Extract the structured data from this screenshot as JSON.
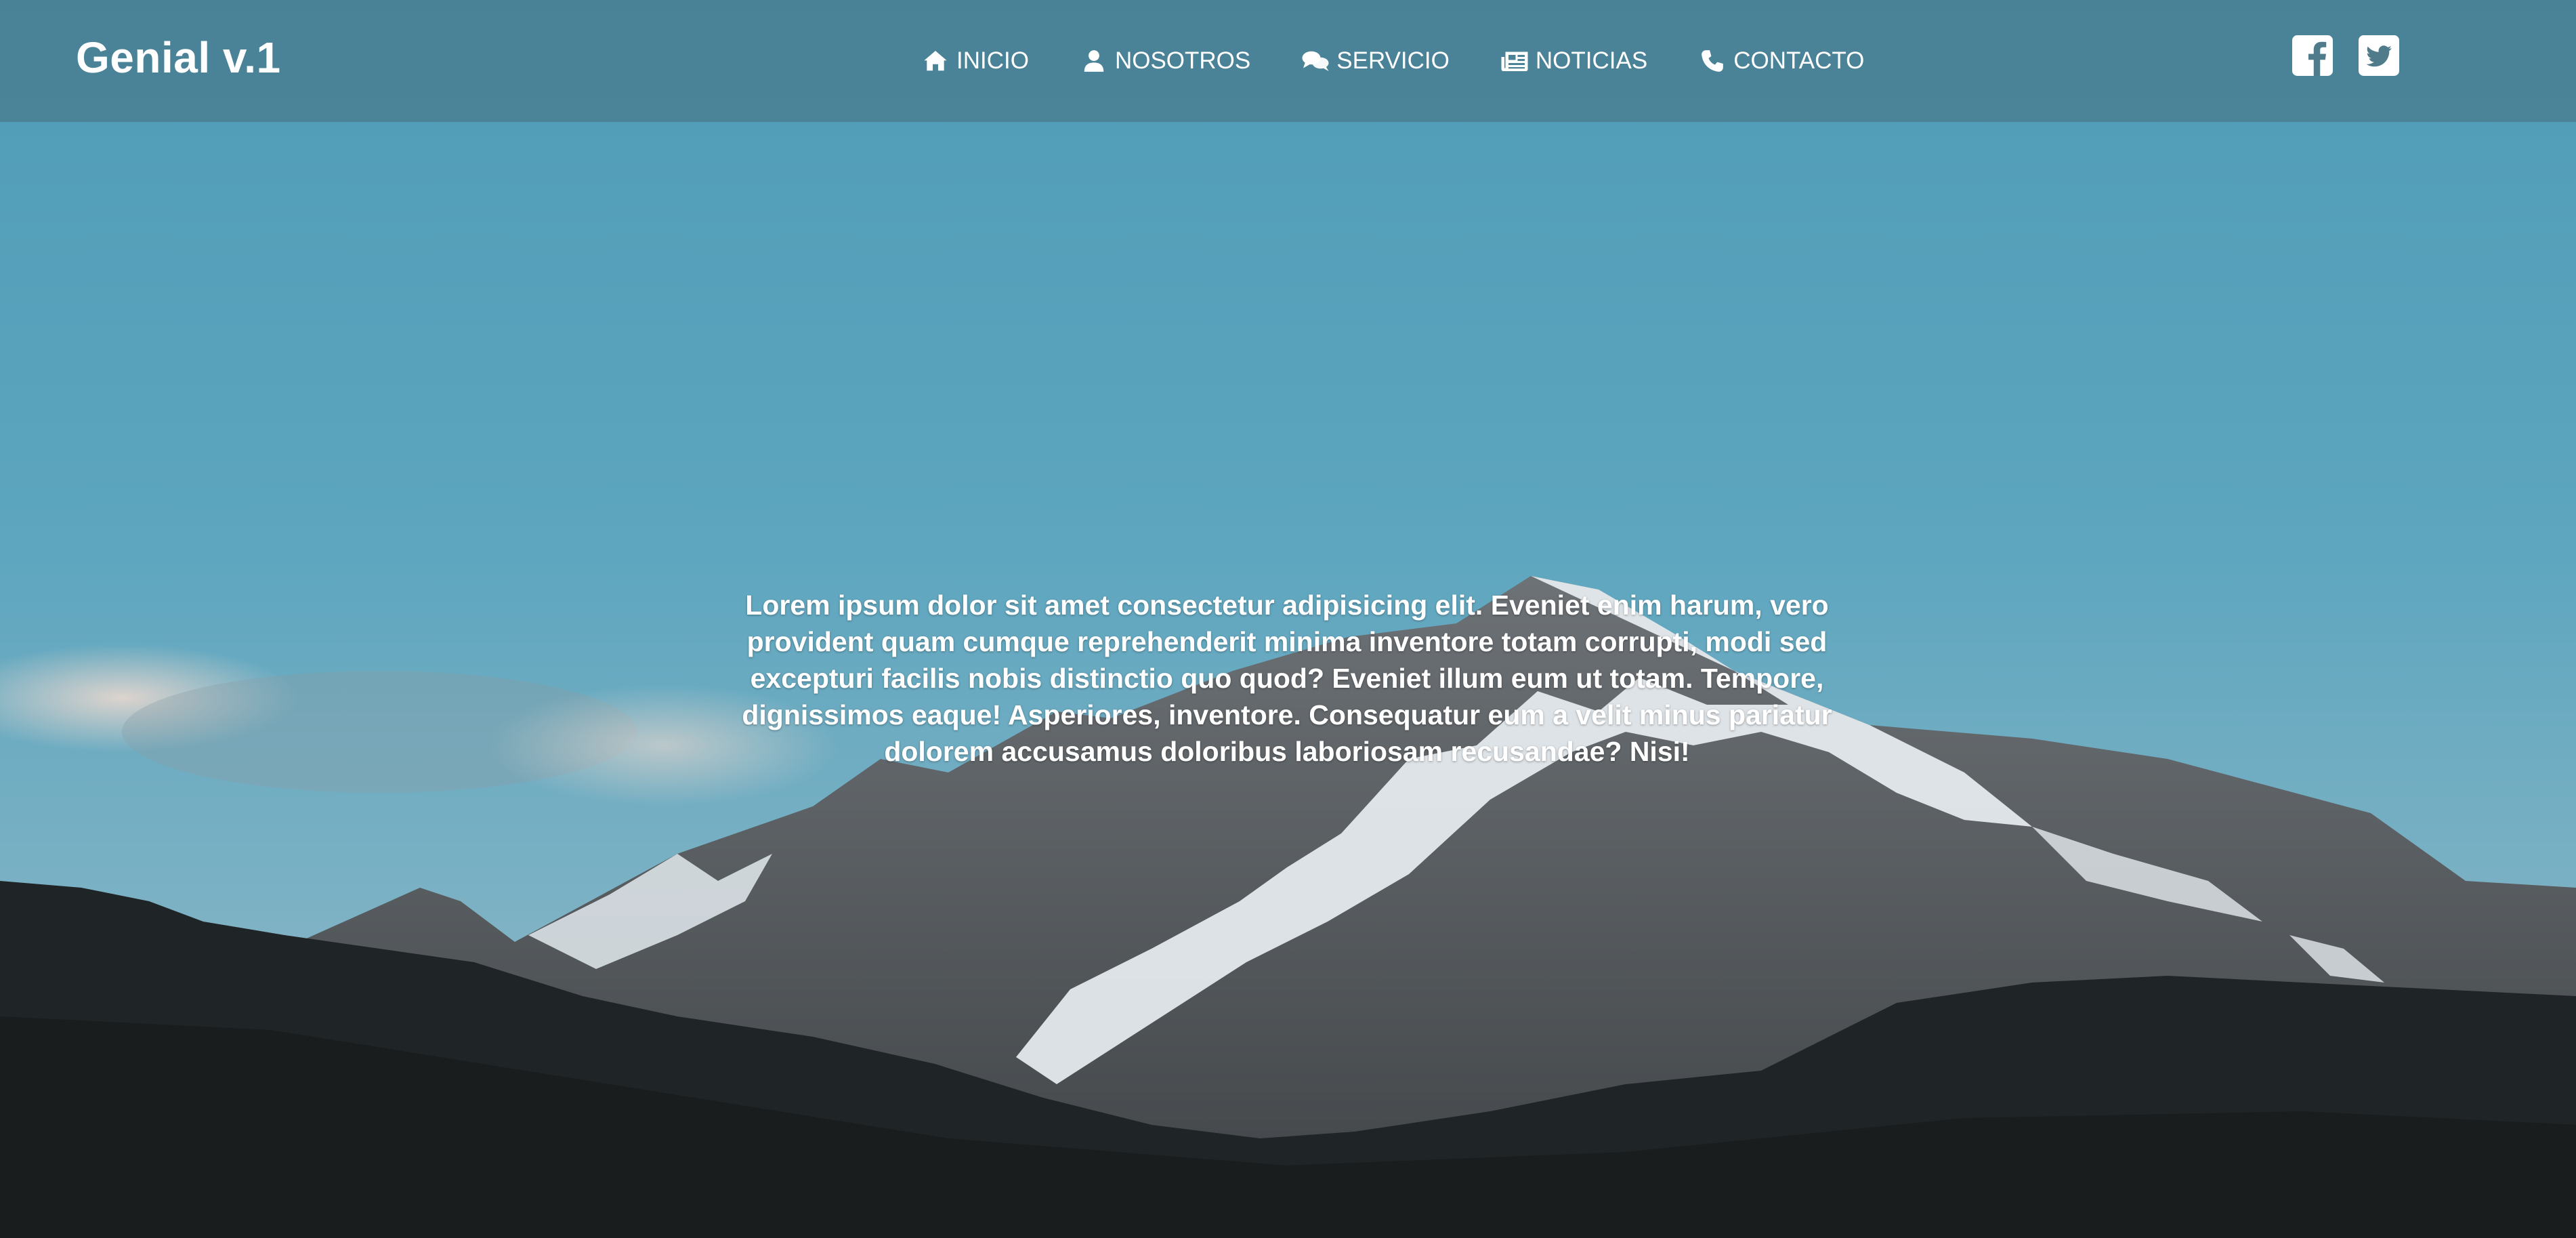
{
  "brand": {
    "title": "Genial v.1"
  },
  "nav": {
    "items": [
      {
        "label": "INICIO",
        "icon": "home-icon"
      },
      {
        "label": "NOSOTROS",
        "icon": "user-icon"
      },
      {
        "label": "SERVICIO",
        "icon": "comments-icon"
      },
      {
        "label": "NOTICIAS",
        "icon": "newspaper-icon"
      },
      {
        "label": "CONTACTO",
        "icon": "phone-icon"
      }
    ]
  },
  "social": {
    "items": [
      {
        "icon": "facebook-square-icon"
      },
      {
        "icon": "twitter-square-icon"
      }
    ]
  },
  "hero": {
    "text": "Lorem ipsum dolor sit amet consectetur adipisicing elit. Eveniet enim harum, vero provident quam cumque reprehenderit minima inventore totam corrupti, modi sed excepturi facilis nobis distinctio quo quod? Eveniet illum eum ut totam. Tempore, dignissimos eaque! Asperiores, inventore. Consequatur eum a velit minus pariatur dolorem accusamus doloribus laboriosam recusandae? Nisi!",
    "background": "mountain-landscape"
  },
  "colors": {
    "text": "#ffffff",
    "navbar_overlay": "#466e7d",
    "sky_top": "#4f9bb7",
    "sky_bottom": "#7ab2c8",
    "forest": "#1d2122"
  }
}
